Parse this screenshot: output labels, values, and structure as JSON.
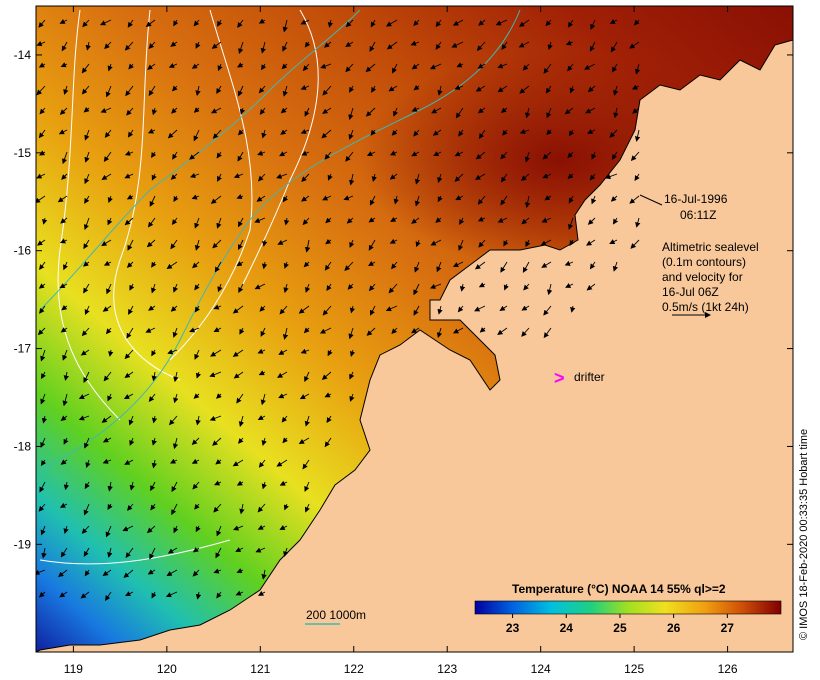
{
  "map": {
    "lat_ticks": [
      "-14",
      "-15",
      "-16",
      "-17",
      "-18",
      "-19"
    ],
    "lon_ticks": [
      "119",
      "120",
      "121",
      "122",
      "123",
      "124",
      "125",
      "126"
    ],
    "lat_range": [
      -20.1,
      -13.5
    ],
    "lon_range": [
      118.6,
      126.7
    ]
  },
  "annotations": {
    "date": "16-Jul-1996",
    "time": "06:11Z",
    "sealevel_lines": [
      "Altimetric sealevel",
      "(0.1m contours)",
      "and velocity for",
      "16-Jul 06Z",
      "0.5m/s (1kt 24h)"
    ],
    "drifter_marker": ">",
    "drifter_label": "drifter",
    "depth_legend": "200  1000m"
  },
  "colorbar": {
    "title": "Temperature (°C) NOAA 14 55% ql>=2",
    "ticks": [
      "23",
      "24",
      "25",
      "26",
      "27"
    ],
    "range": [
      22.3,
      28.0
    ]
  },
  "credit": "© IMOS 18-Feb-2020 00:33:35 Hobart time",
  "colors": {
    "land": "#f8c89a",
    "warm": "#c04a08",
    "hot": "#8a1004",
    "contour": "#ffffff",
    "isobath": "#40b8b0",
    "drifter": "#ff00ff"
  }
}
